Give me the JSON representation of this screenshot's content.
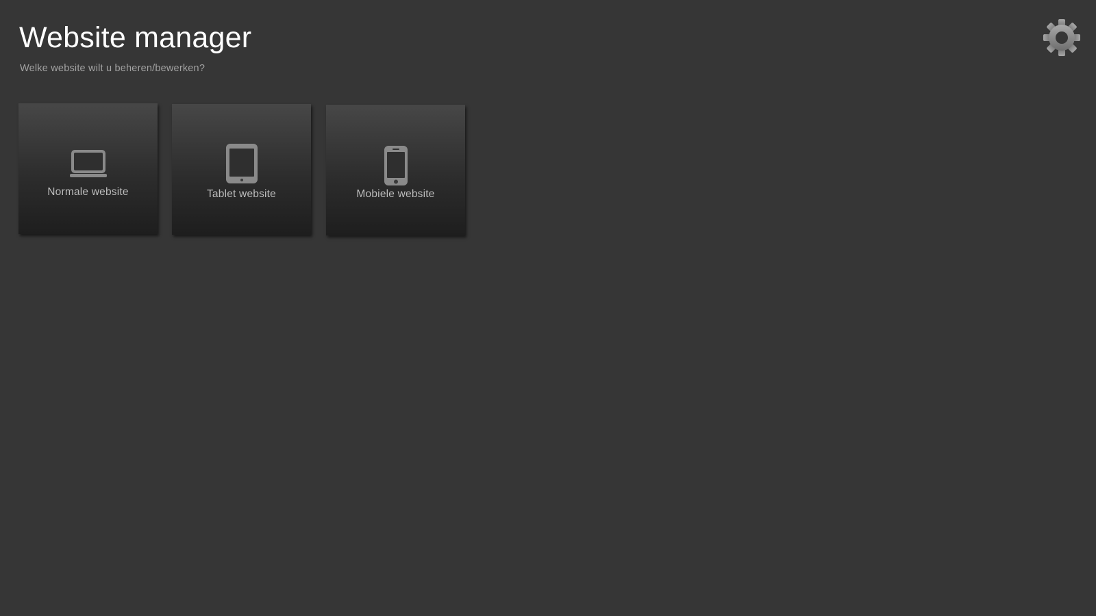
{
  "header": {
    "title": "Website manager",
    "subtitle": "Welke website wilt u beheren/bewerken?"
  },
  "settings": {
    "icon": "gear-icon"
  },
  "tiles": [
    {
      "label": "Normale website",
      "icon": "laptop-icon"
    },
    {
      "label": "Tablet website",
      "icon": "tablet-icon"
    },
    {
      "label": "Mobiele website",
      "icon": "phone-icon"
    }
  ],
  "colors": {
    "background": "#363636",
    "title": "#ffffff",
    "subtitle": "#a3a3a3",
    "tile_label": "#bdbdbd",
    "icon": "#8a8a8a"
  }
}
